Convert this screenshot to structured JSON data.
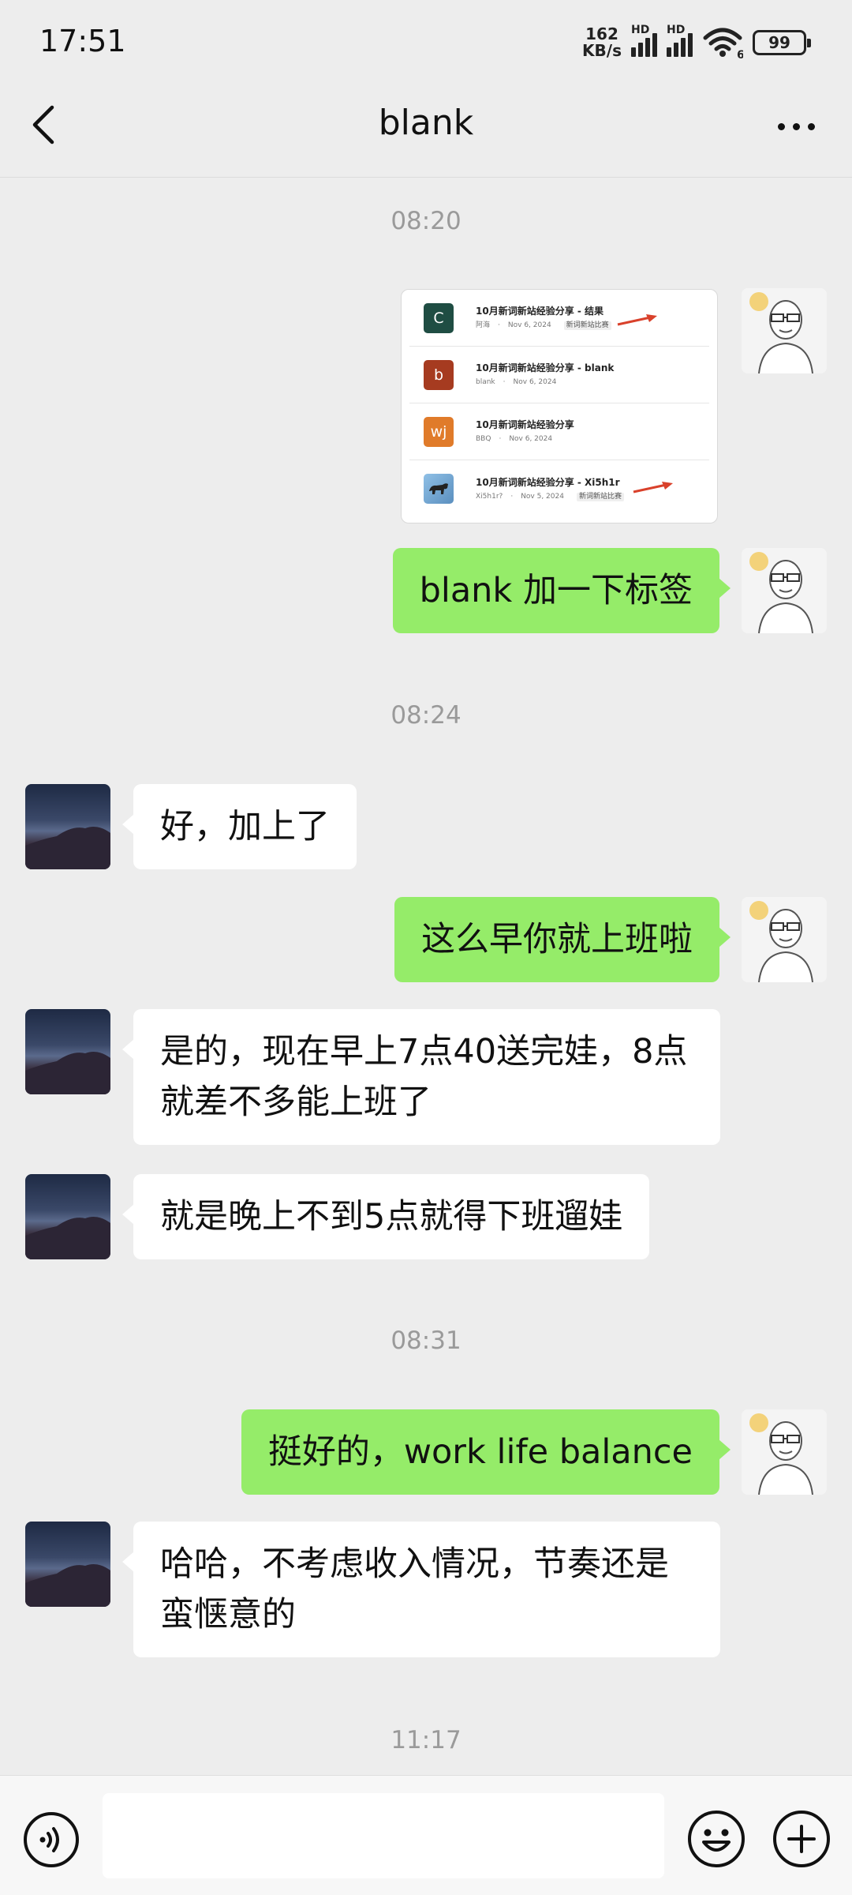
{
  "status_bar": {
    "time": "17:51",
    "net_speed_value": "162",
    "net_speed_unit": "KB/s",
    "signal_label": "HD",
    "wifi_label": "6",
    "battery_level": "99"
  },
  "header": {
    "title": "blank"
  },
  "image_message": {
    "rows": [
      {
        "icon_letter": "C",
        "icon_color": "#1f4d43",
        "title": "10月新词新站经验分享 - 结果",
        "author": "阿海",
        "date": "Nov 6, 2024",
        "tag": "新词新站比赛"
      },
      {
        "icon_letter": "b",
        "icon_color": "#a63b20",
        "title": "10月新词新站经验分享 - blank",
        "author": "blank",
        "date": "Nov 6, 2024",
        "tag": ""
      },
      {
        "icon_letter": "wj",
        "icon_color": "#e07b2a",
        "title": "10月新词新站经验分享",
        "author": "BBQ",
        "date": "Nov 6, 2024",
        "tag": ""
      },
      {
        "icon_letter": "",
        "icon_color": "#6a98c4",
        "title": "10月新词新站经验分享 - Xi5h1r",
        "author": "Xi5h1r?",
        "date": "Nov 5, 2024",
        "tag": "新词新站比赛"
      }
    ]
  },
  "messages": {
    "ts1": "08:20",
    "m1": "blank 加一下标签",
    "ts2": "08:24",
    "m2": "好，加上了",
    "m3": "这么早你就上班啦",
    "m4": "是的，现在早上7点40送完娃，8点就差不多能上班了",
    "m5": "就是晚上不到5点就得下班遛娃",
    "ts3": "08:31",
    "m6": "挺好的，work life balance",
    "m7": "哈哈，不考虑收入情况，节奏还是蛮惬意的",
    "ts4": "11:17"
  },
  "input": {
    "value": ""
  },
  "colors": {
    "outgoing_bubble": "#95ec69",
    "incoming_bubble": "#ffffff",
    "background": "#ededed"
  }
}
